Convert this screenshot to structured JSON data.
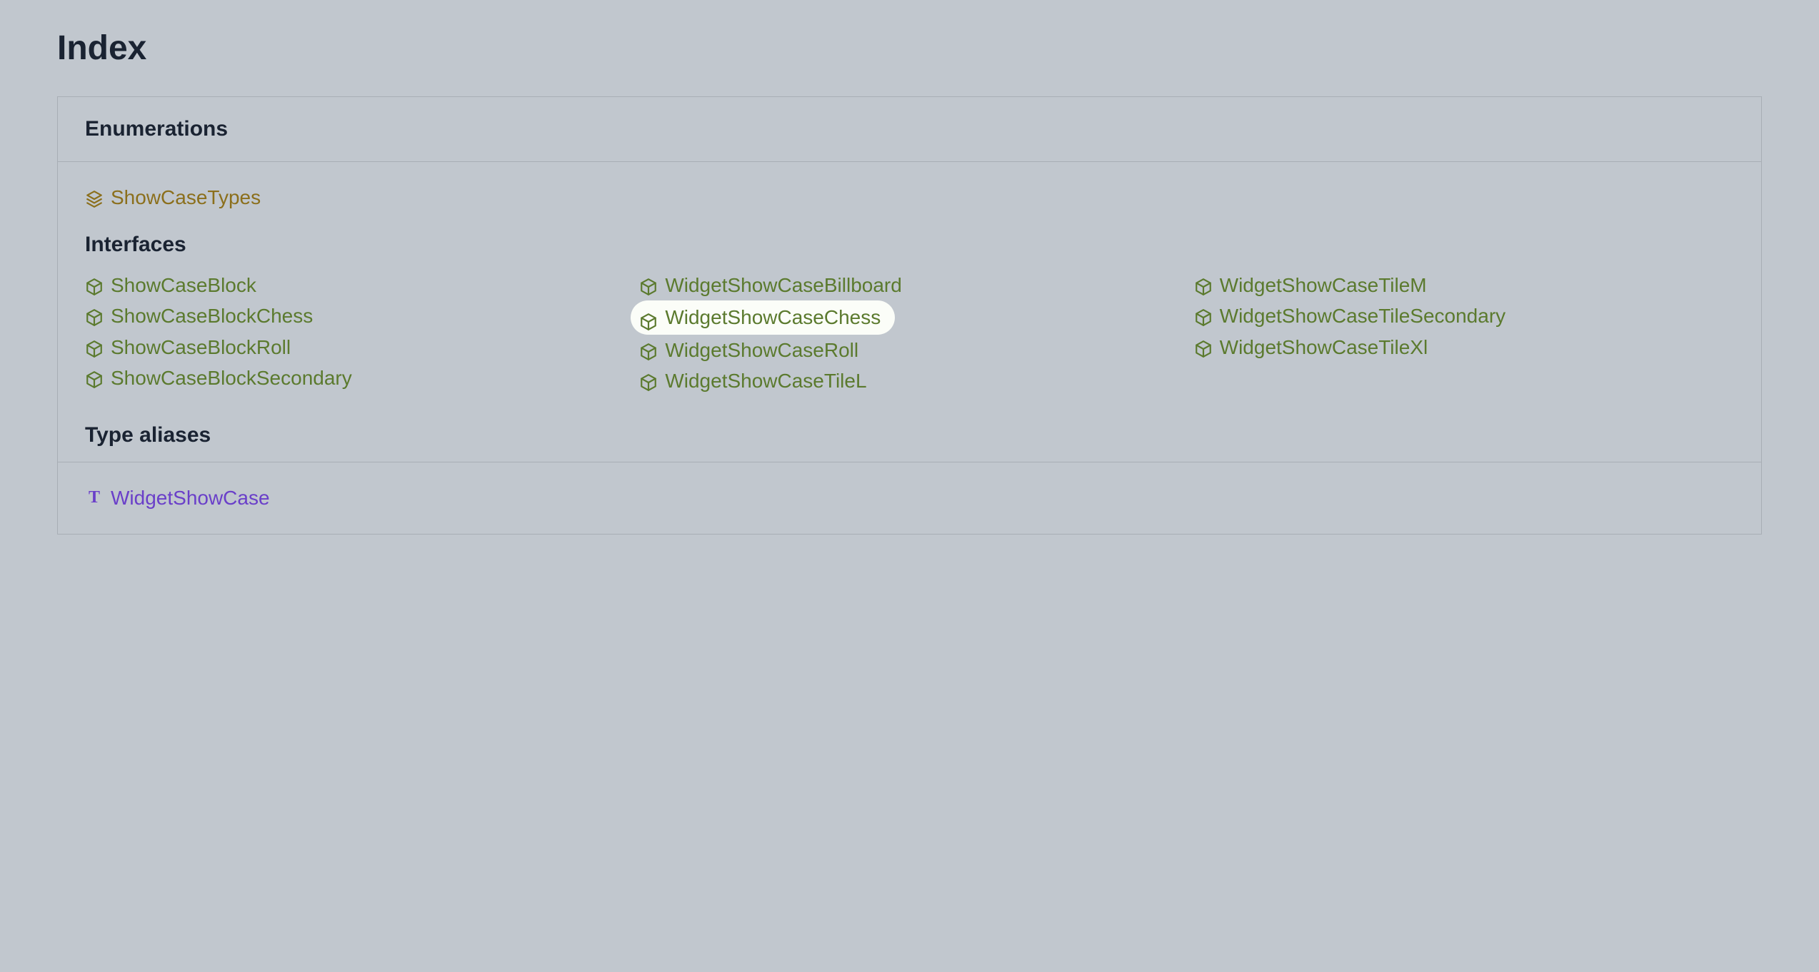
{
  "title": "Index",
  "sections": {
    "enumerations": {
      "heading": "Enumerations",
      "items": [
        "ShowCaseTypes"
      ]
    },
    "interfaces": {
      "heading": "Interfaces",
      "columns": [
        [
          "ShowCaseBlock",
          "ShowCaseBlockChess",
          "ShowCaseBlockRoll",
          "ShowCaseBlockSecondary"
        ],
        [
          "WidgetShowCaseBillboard",
          "WidgetShowCaseChess",
          "WidgetShowCaseRoll",
          "WidgetShowCaseTileL"
        ],
        [
          "WidgetShowCaseTileM",
          "WidgetShowCaseTileSecondary",
          "WidgetShowCaseTileXl"
        ]
      ],
      "highlighted": "WidgetShowCaseChess"
    },
    "type_aliases": {
      "heading": "Type aliases",
      "items": [
        "WidgetShowCase"
      ]
    }
  }
}
